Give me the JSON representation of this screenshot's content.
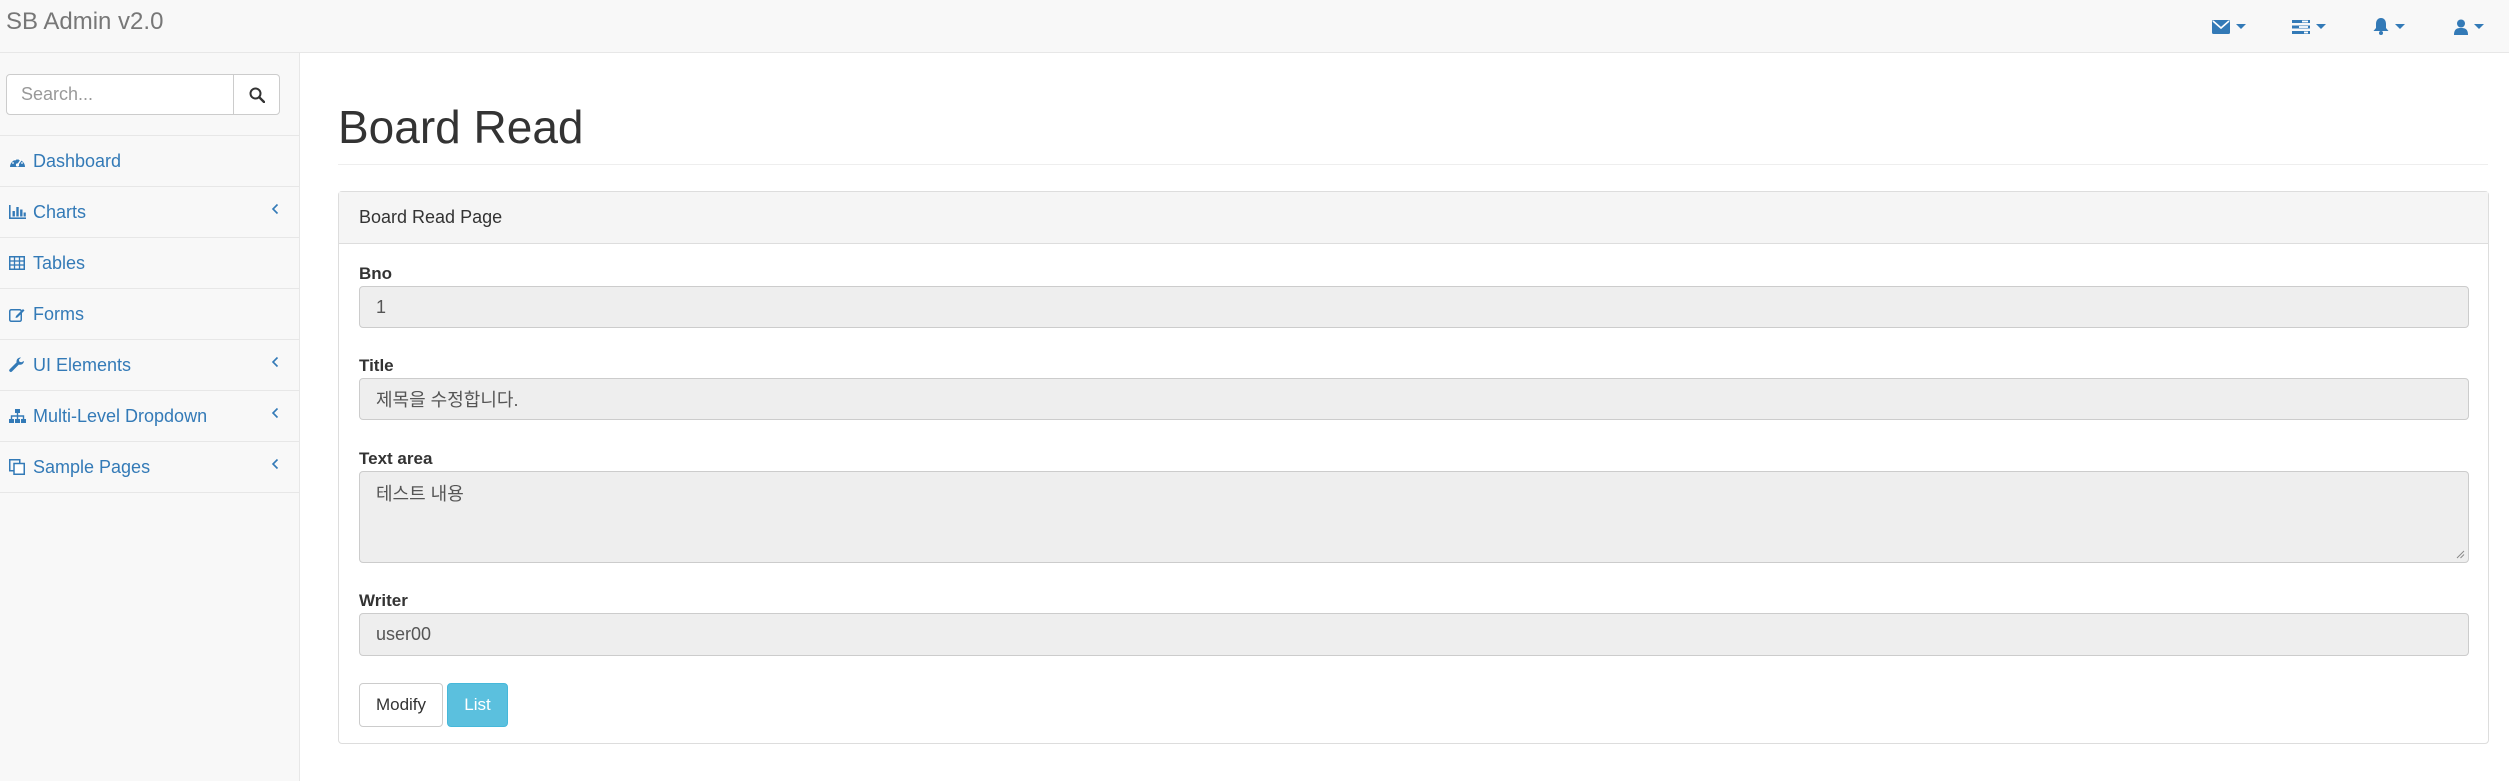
{
  "navbar": {
    "brand": "SB Admin v2.0",
    "icons": [
      "envelope-icon",
      "tasks-icon",
      "bell-icon",
      "user-icon"
    ]
  },
  "sidebar": {
    "search_placeholder": "Search...",
    "items": [
      {
        "label": "Dashboard",
        "icon": "dashboard-icon",
        "has_arrow": false
      },
      {
        "label": "Charts",
        "icon": "bar-chart-icon",
        "has_arrow": true
      },
      {
        "label": "Tables",
        "icon": "table-icon",
        "has_arrow": false
      },
      {
        "label": "Forms",
        "icon": "edit-icon",
        "has_arrow": false
      },
      {
        "label": "UI Elements",
        "icon": "wrench-icon",
        "has_arrow": true
      },
      {
        "label": "Multi-Level Dropdown",
        "icon": "sitemap-icon",
        "has_arrow": true
      },
      {
        "label": "Sample Pages",
        "icon": "files-icon",
        "has_arrow": true
      }
    ]
  },
  "main": {
    "title": "Board Read",
    "panel_heading": "Board Read Page",
    "fields": {
      "bno": {
        "label": "Bno",
        "value": "1"
      },
      "title": {
        "label": "Title",
        "value": "제목을 수정합니다."
      },
      "content": {
        "label": "Text area",
        "value": "테스트 내용"
      },
      "writer": {
        "label": "Writer",
        "value": "user00"
      }
    },
    "buttons": {
      "modify": "Modify",
      "list": "List"
    }
  },
  "colors": {
    "link": "#337ab7",
    "info": "#5bc0de",
    "readonly_bg": "#eeeeee"
  }
}
